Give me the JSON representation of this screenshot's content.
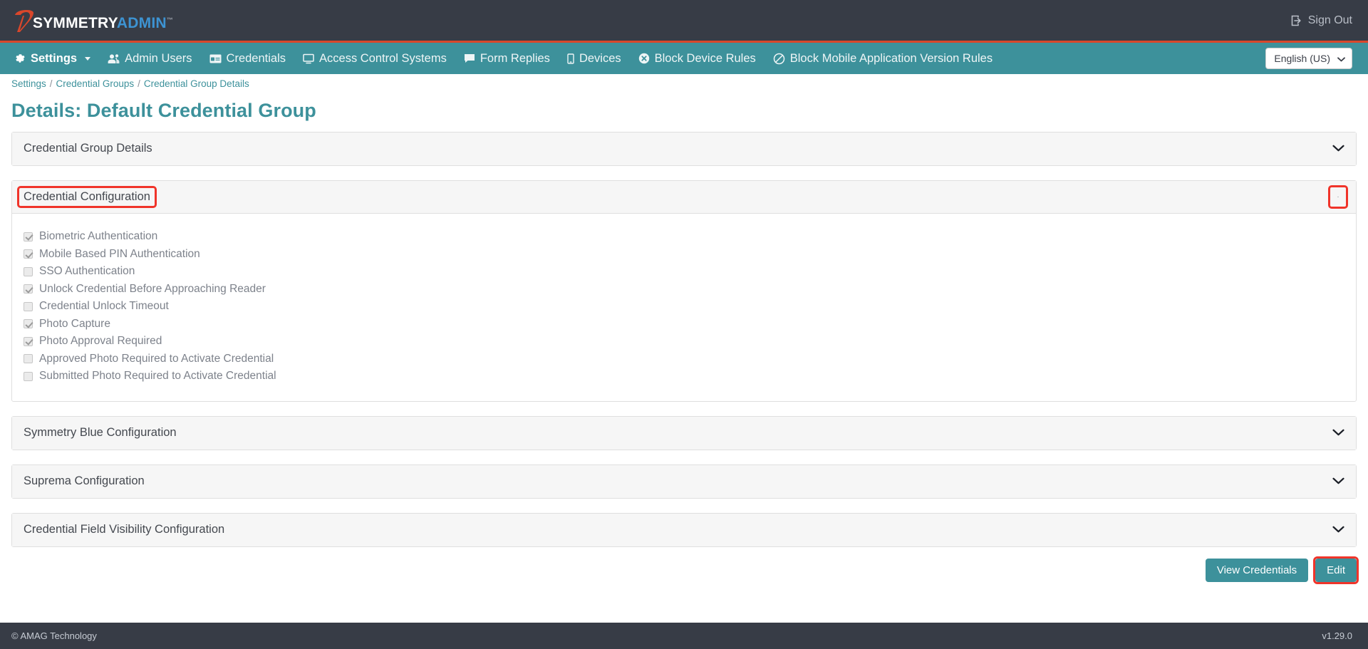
{
  "header": {
    "logo": {
      "primary": "SYMMETRY",
      "secondary": "ADMIN",
      "tm": "™"
    },
    "sign_out": "Sign Out"
  },
  "nav": {
    "items": [
      {
        "label": "Settings",
        "icon": "gear-icon",
        "has_caret": true
      },
      {
        "label": "Admin Users",
        "icon": "users-icon",
        "has_caret": false
      },
      {
        "label": "Credentials",
        "icon": "card-icon",
        "has_caret": false
      },
      {
        "label": "Access Control Systems",
        "icon": "monitor-icon",
        "has_caret": false
      },
      {
        "label": "Form Replies",
        "icon": "comment-icon",
        "has_caret": false
      },
      {
        "label": "Devices",
        "icon": "mobile-icon",
        "has_caret": false
      },
      {
        "label": "Block Device Rules",
        "icon": "times-circle-icon",
        "has_caret": false
      },
      {
        "label": "Block Mobile Application Version Rules",
        "icon": "ban-icon",
        "has_caret": false
      }
    ],
    "language": {
      "value": "English (US)",
      "icon": "chevron-down-icon"
    }
  },
  "breadcrumb": {
    "items": [
      "Settings",
      "Credential Groups",
      "Credential Group Details"
    ],
    "separator": "/"
  },
  "page": {
    "title": "Details: Default Credential Group"
  },
  "panels": [
    {
      "title": "Credential Group Details",
      "open": false,
      "highlight_title": false,
      "highlight_chevron": false,
      "chevron_icon": "chevron-down-icon"
    },
    {
      "title": "Credential Configuration",
      "open": true,
      "highlight_title": true,
      "highlight_chevron": true,
      "chevron_icon": "chevron-down-icon",
      "checkboxes": [
        {
          "label": "Biometric Authentication",
          "checked": true
        },
        {
          "label": "Mobile Based PIN Authentication",
          "checked": true
        },
        {
          "label": "SSO Authentication",
          "checked": false
        },
        {
          "label": "Unlock Credential Before Approaching Reader",
          "checked": true
        },
        {
          "label": "Credential Unlock Timeout",
          "checked": false
        },
        {
          "label": "Photo Capture",
          "checked": true
        },
        {
          "label": "Photo Approval Required",
          "checked": true
        },
        {
          "label": "Approved Photo Required to Activate Credential",
          "checked": false
        },
        {
          "label": "Submitted Photo Required to Activate Credential",
          "checked": false
        }
      ]
    },
    {
      "title": "Symmetry Blue Configuration",
      "open": false,
      "highlight_title": false,
      "highlight_chevron": false,
      "chevron_icon": "chevron-down-icon"
    },
    {
      "title": "Suprema Configuration",
      "open": false,
      "highlight_title": false,
      "highlight_chevron": false,
      "chevron_icon": "chevron-down-icon"
    },
    {
      "title": "Credential Field Visibility Configuration",
      "open": false,
      "highlight_title": false,
      "highlight_chevron": false,
      "chevron_icon": "chevron-down-icon"
    }
  ],
  "actions": {
    "view_credentials": "View Credentials",
    "edit": "Edit",
    "edit_highlighted": true
  },
  "footer": {
    "copyright": "© AMAG Technology",
    "version": "v1.29.0"
  },
  "colors": {
    "header_dark": "#373c46",
    "accent_red": "#d9472b",
    "teal": "#3d919b",
    "highlight_red": "#f0342a",
    "logo_blue": "#3d93d2"
  }
}
